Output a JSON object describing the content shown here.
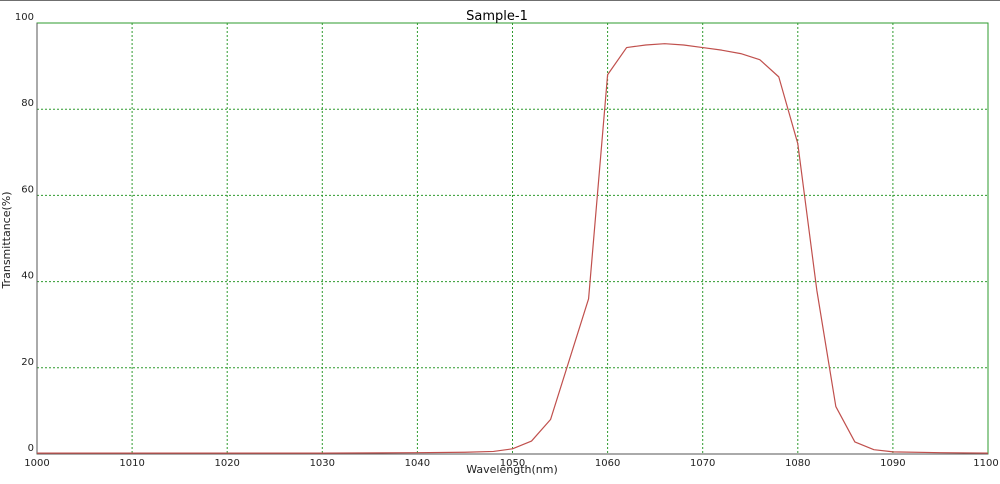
{
  "chart_data": {
    "type": "line",
    "title": "Sample-1",
    "xlabel": "Wavelength(nm)",
    "ylabel": "Transmittance(%)",
    "xlim": [
      1000,
      1100
    ],
    "ylim": [
      0,
      100
    ],
    "xticks": [
      1000,
      1010,
      1020,
      1030,
      1040,
      1050,
      1060,
      1070,
      1080,
      1090,
      1100
    ],
    "yticks": [
      0,
      20,
      40,
      60,
      80,
      100
    ],
    "grid": true,
    "legend": "none",
    "colors": {
      "line": "#c0504d",
      "grid": "#2e9b2e",
      "plot_border": "#2e9b2e",
      "axis": "#555555"
    },
    "series": [
      {
        "x": [
          1000,
          1010,
          1020,
          1030,
          1040,
          1045,
          1048,
          1050,
          1052,
          1054,
          1056,
          1058,
          1060,
          1062,
          1064,
          1066,
          1068,
          1070,
          1072,
          1074,
          1076,
          1078,
          1080,
          1082,
          1084,
          1086,
          1088,
          1090,
          1095,
          1100
        ],
        "y": [
          0.2,
          0.2,
          0.2,
          0.2,
          0.3,
          0.4,
          0.6,
          1.2,
          3,
          8,
          22,
          36,
          88,
          94.3,
          94.9,
          95.2,
          94.9,
          94.3,
          93.7,
          92.9,
          91.5,
          87.5,
          72,
          38,
          11,
          2.8,
          1,
          0.5,
          0.3,
          0.2
        ]
      }
    ]
  }
}
